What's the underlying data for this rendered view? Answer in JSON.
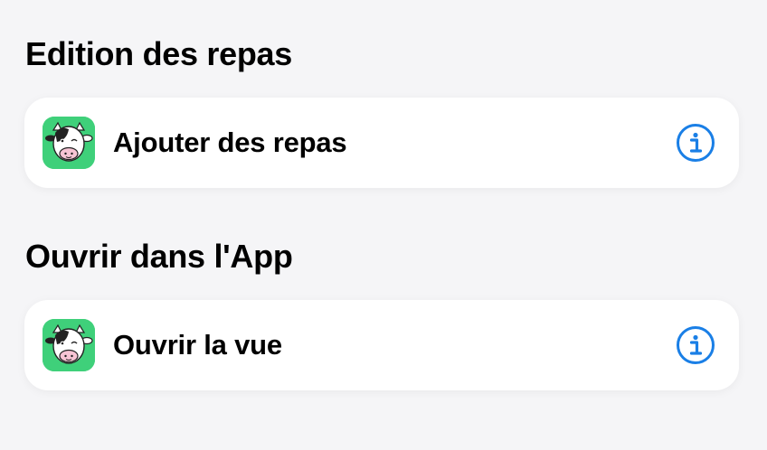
{
  "sections": [
    {
      "title": "Edition des repas",
      "item": {
        "label": "Ajouter des repas",
        "icon": "cow-app-icon",
        "action_icon": "info-icon"
      }
    },
    {
      "title": "Ouvrir dans l'App",
      "item": {
        "label": "Ouvrir la vue",
        "icon": "cow-app-icon",
        "action_icon": "info-icon"
      }
    }
  ],
  "colors": {
    "background": "#f5f5f7",
    "card": "#ffffff",
    "accent": "#1a7fe6",
    "app_icon_bg": "#3fd07a"
  }
}
